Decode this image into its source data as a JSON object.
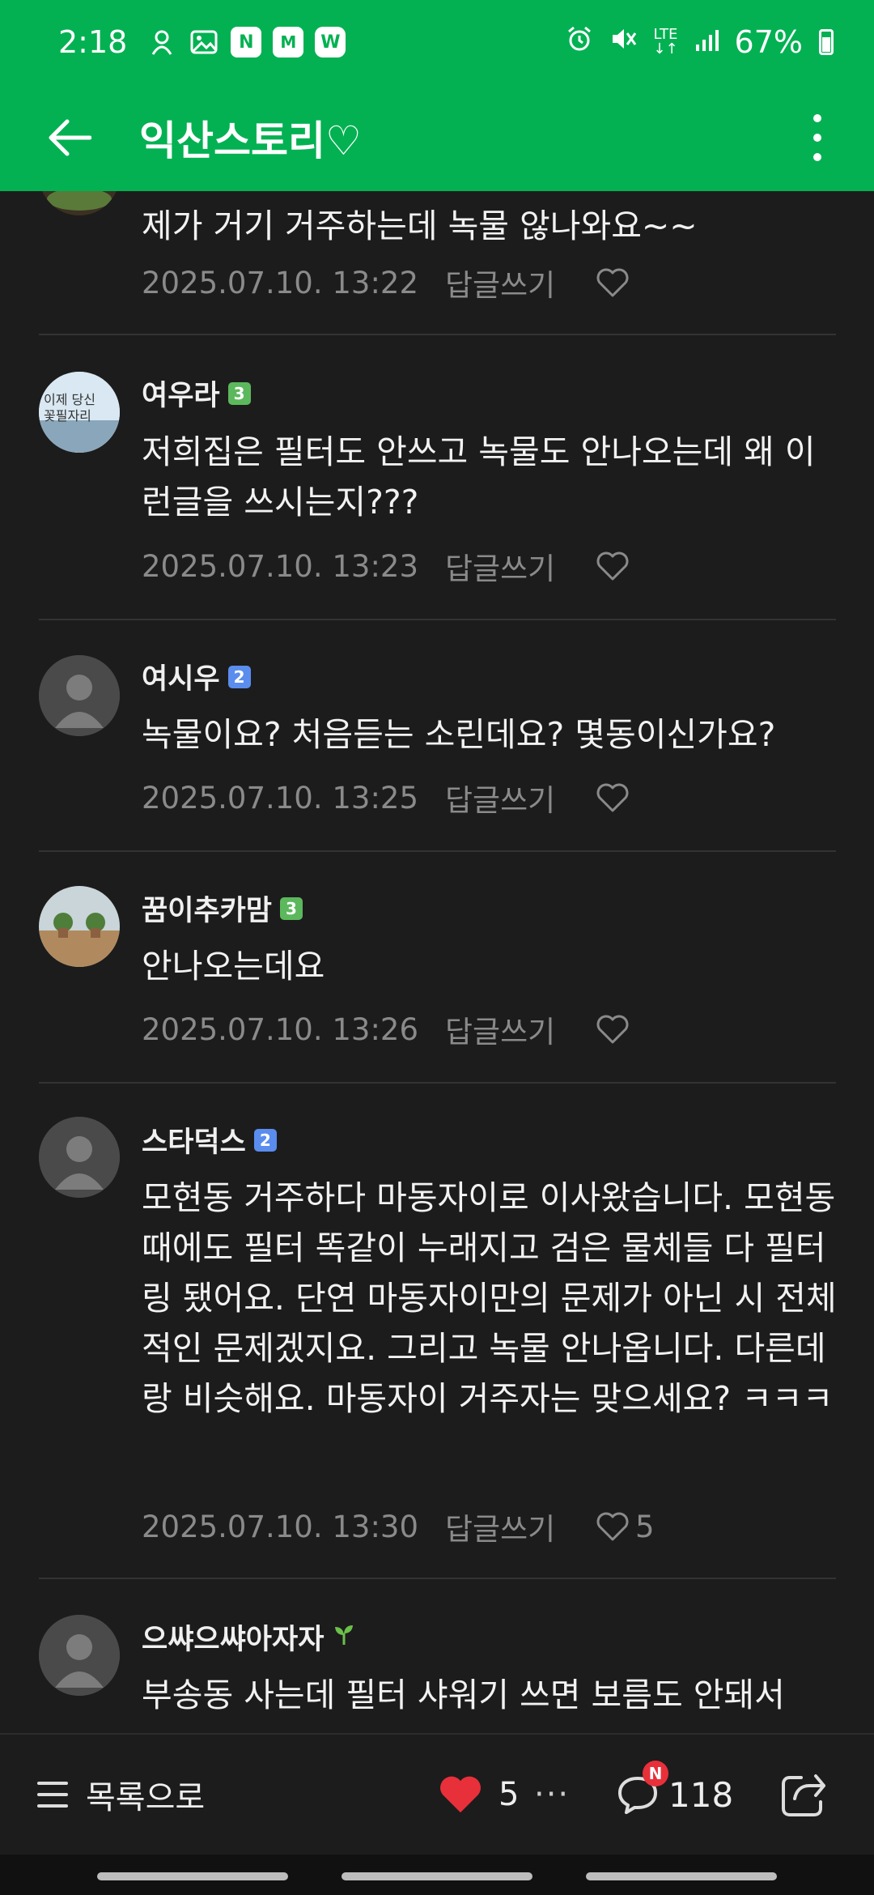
{
  "status": {
    "time": "2:18",
    "left_icons": [
      "app-notification-icon",
      "gallery-icon",
      "naver-icon",
      "mstock-icon",
      "webtoon-icon"
    ],
    "lte": "LTE",
    "battery": "67%"
  },
  "appbar": {
    "title": "익산스토리♡"
  },
  "comments": [
    {
      "author": "",
      "badge": "",
      "text": "제가 거기 거주하는데 녹물 않나와요~~",
      "date": "2025.07.10. 13:22",
      "reply": "답글쓰기",
      "likes": ""
    },
    {
      "author": "여우라",
      "badge": "3",
      "text": "저희집은 필터도 안쓰고 녹물도 안나오는데 왜 이런글을 쓰시는지???",
      "date": "2025.07.10. 13:23",
      "reply": "답글쓰기",
      "likes": ""
    },
    {
      "author": "여시우",
      "badge": "2",
      "text": "녹물이요? 처음듣는 소린데요? 몇동이신가요?",
      "date": "2025.07.10. 13:25",
      "reply": "답글쓰기",
      "likes": ""
    },
    {
      "author": "꿈이추카맘",
      "badge": "3",
      "text": "안나오는데요",
      "date": "2025.07.10. 13:26",
      "reply": "답글쓰기",
      "likes": ""
    },
    {
      "author": "스타덕스",
      "badge": "2",
      "text": "모현동 거주하다 마동자이로 이사왔습니다. 모현동때에도 필터 똑같이 누래지고 검은 물체들 다 필터링 됐어요. 단연 마동자이만의 문제가 아닌 시 전체적인 문제겠지요. 그리고 녹물 안나옵니다. 다른데랑 비슷해요. 마동자이 거주자는 맞으세요? ㅋㅋㅋ",
      "date": "2025.07.10. 13:30",
      "reply": "답글쓰기",
      "likes": "5"
    },
    {
      "author": "으쌰으쌰아자자",
      "badge": "",
      "text": "부송동 사는데 필터 샤워기 쓰면 보름도 안돼서",
      "date": "",
      "reply": "",
      "likes": ""
    }
  ],
  "bottom": {
    "list_label": "목록으로",
    "like_count": "5",
    "more": "···",
    "comment_badge": "N",
    "comment_count": "118"
  },
  "colors": {
    "accent": "#03b152",
    "background": "#1c1c1c",
    "heart": "#e8303a"
  }
}
